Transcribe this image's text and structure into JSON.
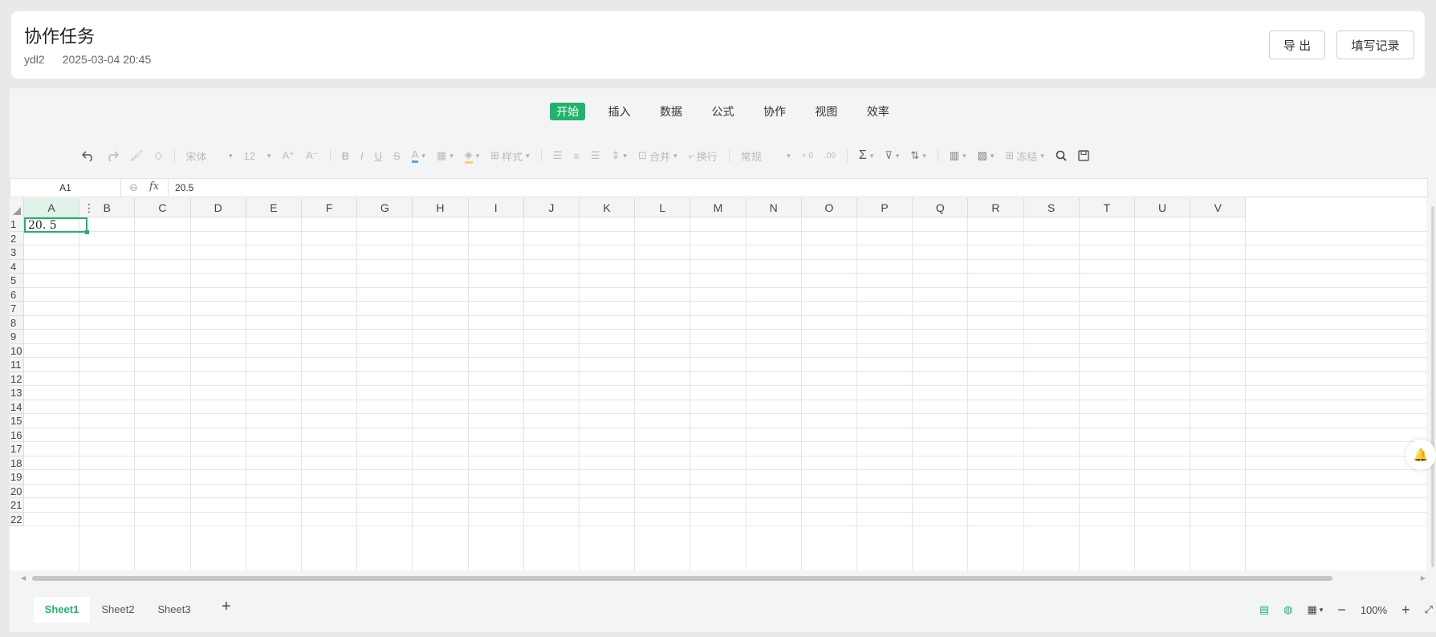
{
  "header": {
    "title": "协作任务",
    "user": "ydl2",
    "datetime": "2025-03-04 20:45",
    "export_label": "导 出",
    "record_label": "填写记录"
  },
  "menu_tabs": [
    "开始",
    "插入",
    "数据",
    "公式",
    "协作",
    "视图",
    "效率"
  ],
  "active_menu_tab": "开始",
  "toolbar": {
    "font_name": "宋体",
    "font_size": "12",
    "style_label": "样式",
    "merge_label": "合并",
    "wrap_label": "换行",
    "number_format": "常规",
    "freeze_label": "冻结"
  },
  "formula_bar": {
    "cell_ref": "A1",
    "fx_label": "fx",
    "value": "20.5"
  },
  "grid": {
    "columns": [
      "A",
      "B",
      "C",
      "D",
      "E",
      "F",
      "G",
      "H",
      "I",
      "J",
      "K",
      "L",
      "M",
      "N",
      "O",
      "P",
      "Q",
      "R",
      "S",
      "T",
      "U",
      "V"
    ],
    "rows": [
      "1",
      "2",
      "3",
      "4",
      "5",
      "6",
      "7",
      "8",
      "9",
      "10",
      "11",
      "12",
      "13",
      "14",
      "15",
      "16",
      "17",
      "18",
      "19",
      "20",
      "21",
      "22"
    ],
    "selected_cell": "A1",
    "active_cell_text": "20. 5"
  },
  "sheets": [
    "Sheet1",
    "Sheet2",
    "Sheet3"
  ],
  "active_sheet": "Sheet1",
  "status": {
    "zoom": "100%"
  },
  "colors": {
    "accent": "#21b36b"
  }
}
